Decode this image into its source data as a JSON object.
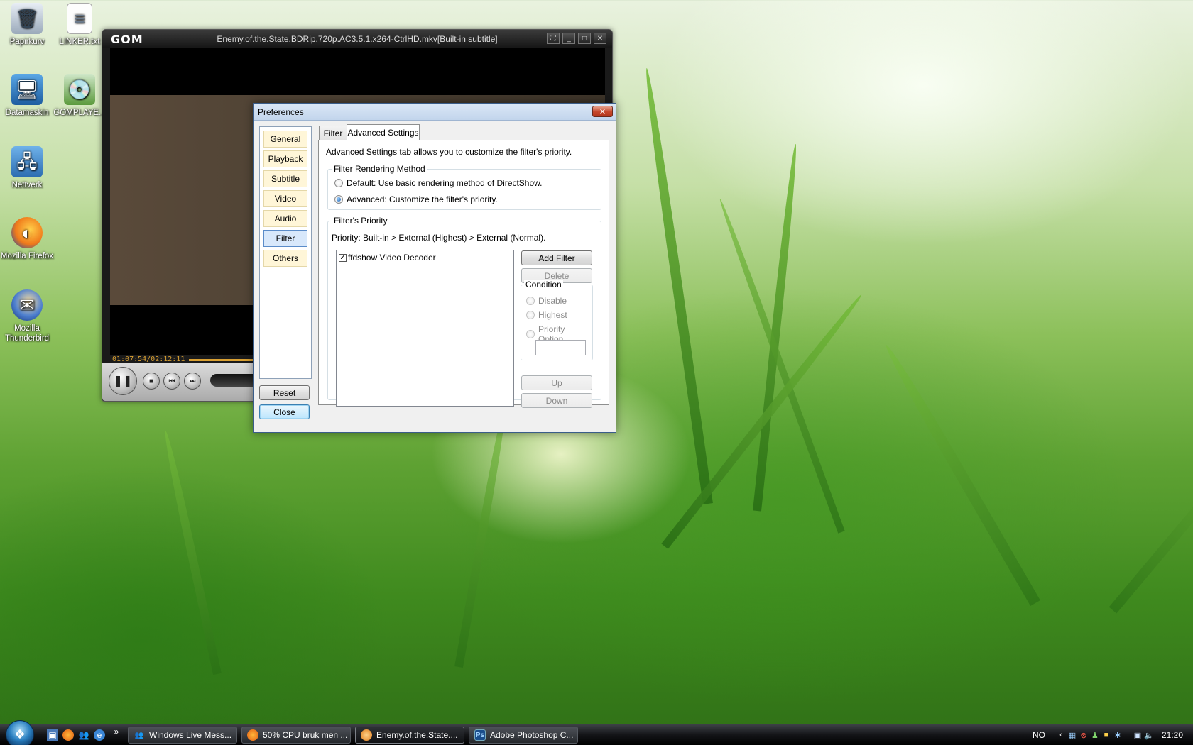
{
  "desktop": {
    "icons": [
      {
        "label": "Papirkurv",
        "icon": "recycle-bin-icon"
      },
      {
        "label": "LINKER.txt",
        "icon": "text-file-icon"
      },
      {
        "label": "Datamaskin",
        "icon": "computer-icon"
      },
      {
        "label": "GOMPLAYE...",
        "icon": "installer-icon"
      },
      {
        "label": "Nettverk",
        "icon": "network-icon"
      },
      {
        "label": "Mozilla Firefox",
        "icon": "firefox-icon"
      },
      {
        "label": "Mozilla Thunderbird",
        "icon": "thunderbird-icon"
      }
    ]
  },
  "gom": {
    "logo": "GOM",
    "title": "Enemy.of.the.State.BDRip.720p.AC3.5.1.x264-CtrlHD.mkv[Built-in subtitle]",
    "time": "01:07:54/02:12:11",
    "progress": 0.514,
    "controls": {
      "fullscreen": "⛶",
      "minimize": "_",
      "maximize": "□",
      "close": "✕"
    }
  },
  "prefs": {
    "title": "Preferences",
    "close_glyph": "✕",
    "nav": [
      "General",
      "Playback",
      "Subtitle",
      "Video",
      "Audio",
      "Filter",
      "Others"
    ],
    "active_nav": "Filter",
    "reset": "Reset",
    "close": "Close",
    "tabs": [
      "Filter",
      "Advanced Settings"
    ],
    "active_tab": "Advanced Settings",
    "description": "Advanced Settings tab allows you to customize the filter's priority.",
    "rendering": {
      "label": "Filter Rendering Method",
      "default_option": "Default: Use basic rendering method of DirectShow.",
      "advanced_option": "Advanced: Customize the filter's priority.",
      "selected": "advanced"
    },
    "priority": {
      "label": "Filter's Priority",
      "text": "Priority: Built-in > External (Highest) > External (Normal).",
      "filters": [
        {
          "name": "ffdshow Video Decoder",
          "checked": true
        }
      ],
      "add_filter": "Add Filter",
      "delete": "Delete",
      "condition": {
        "label": "Condition",
        "options": [
          "Disable",
          "Highest",
          "Priority Option"
        ]
      },
      "priority_value": "",
      "up": "Up",
      "down": "Down"
    }
  },
  "taskbar": {
    "tasks": [
      {
        "label": "Windows Live Mess...",
        "icon": "messenger-icon"
      },
      {
        "label": "50% CPU bruk men ...",
        "icon": "firefox-icon"
      },
      {
        "label": "Enemy.of.the.State....",
        "icon": "gom-icon",
        "active": true
      },
      {
        "label": "Adobe Photoshop C...",
        "icon": "photoshop-icon"
      }
    ],
    "language": "NO",
    "clock": "21:20",
    "expand": "»"
  }
}
